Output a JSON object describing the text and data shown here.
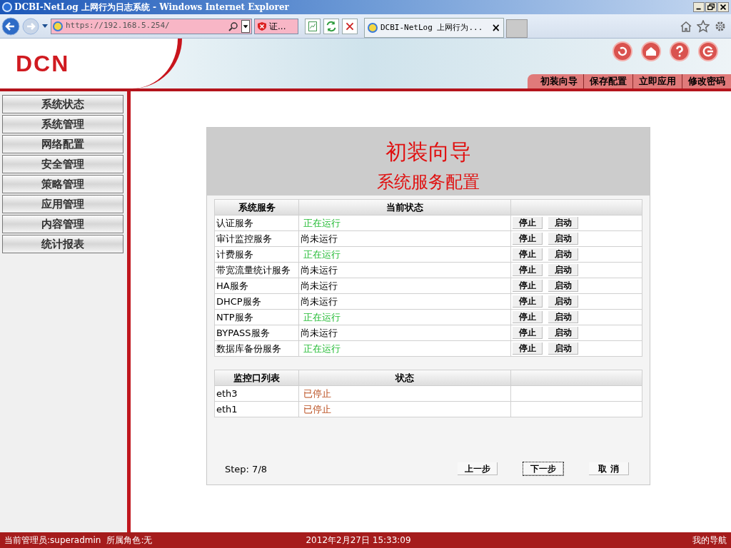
{
  "window": {
    "title": "DCBI-NetLog 上网行为日志系统 - Windows Internet Explorer"
  },
  "browser": {
    "address": "https://192.168.5.254/",
    "cert_label": "证...",
    "tab_title": "DCBI-NetLog 上网行为...",
    "tab_close": "×"
  },
  "header": {
    "logo": "DCN",
    "links": [
      "初装向导",
      "保存配置",
      "立即应用",
      "修改密码"
    ]
  },
  "sidebar": {
    "items": [
      {
        "label": "系统状态",
        "selected": false
      },
      {
        "label": "系统管理",
        "selected": false
      },
      {
        "label": "网络配置",
        "selected": false
      },
      {
        "label": "安全管理",
        "selected": false
      },
      {
        "label": "策略管理",
        "selected": false
      },
      {
        "label": "应用管理",
        "selected": false
      },
      {
        "label": "内容管理",
        "selected": false
      },
      {
        "label": "统计报表",
        "selected": false
      }
    ]
  },
  "wizard": {
    "title": "初装向导",
    "subtitle": "系统服务配置",
    "services": {
      "columns": [
        "系统服务",
        "当前状态"
      ],
      "rows": [
        {
          "name": "认证服务",
          "status": "正在运行",
          "kind": "running",
          "actions": [
            "停止",
            "启动"
          ]
        },
        {
          "name": "审计监控服务",
          "status": "尚未运行",
          "kind": "idle",
          "actions": [
            "停止",
            "启动"
          ]
        },
        {
          "name": "计费服务",
          "status": "正在运行",
          "kind": "running",
          "actions": [
            "停止",
            "启动"
          ]
        },
        {
          "name": "带宽流量统计服务",
          "status": "尚未运行",
          "kind": "idle",
          "actions": [
            "停止",
            "启动"
          ]
        },
        {
          "name": "HA服务",
          "status": "尚未运行",
          "kind": "idle",
          "actions": [
            "停止",
            "启动"
          ]
        },
        {
          "name": "DHCP服务",
          "status": "尚未运行",
          "kind": "idle",
          "actions": [
            "停止",
            "启动"
          ]
        },
        {
          "name": "NTP服务",
          "status": "正在运行",
          "kind": "running",
          "actions": [
            "停止",
            "启动"
          ]
        },
        {
          "name": "BYPASS服务",
          "status": "尚未运行",
          "kind": "idle",
          "actions": [
            "停止",
            "启动"
          ]
        },
        {
          "name": "数据库备份服务",
          "status": "正在运行",
          "kind": "running",
          "actions": [
            "停止",
            "启动"
          ]
        }
      ]
    },
    "ports": {
      "columns": [
        "监控口列表",
        "状态"
      ],
      "rows": [
        {
          "name": "eth3",
          "status": "已停止",
          "kind": "stopped"
        },
        {
          "name": "eth1",
          "status": "已停止",
          "kind": "stopped"
        }
      ]
    },
    "step": "Step: 7/8",
    "buttons": [
      {
        "label": "上一步",
        "focused": false
      },
      {
        "label": "下一步",
        "focused": true
      },
      {
        "label": "取 消",
        "focused": false
      }
    ]
  },
  "status_bar": {
    "user": "当前管理员:superadmin",
    "role": "所属角色:无",
    "datetime": "2012年2月27日 15:33:09",
    "nav": "我的导航"
  }
}
